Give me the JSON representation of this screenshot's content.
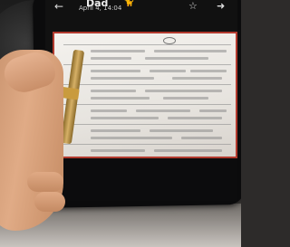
{
  "message_header": {
    "contact_name": "Dad",
    "contact_emoji": "🐈",
    "timestamp": "April 4, 14:04",
    "back_icon": "back-arrow-icon",
    "star_icon": "star-icon",
    "share_icon": "share-icon"
  },
  "attachment": {
    "type": "photo",
    "subject": "printed form document with paper clip",
    "border_color": "#b23a2e"
  }
}
